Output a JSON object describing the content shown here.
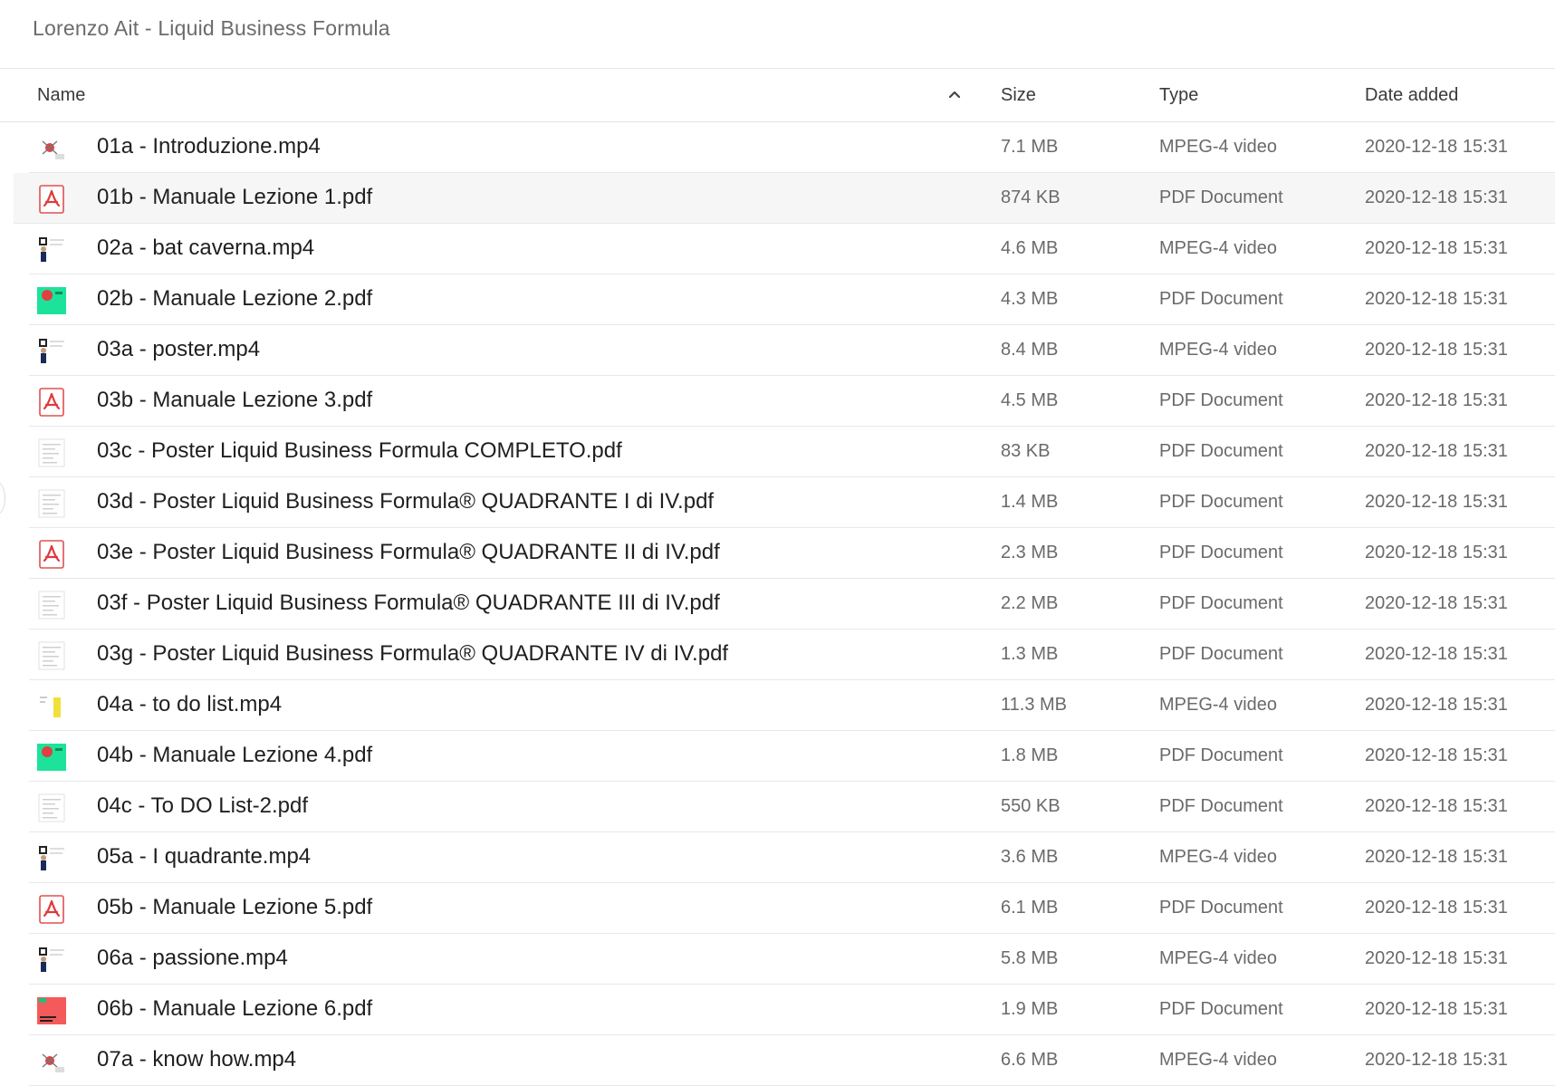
{
  "window": {
    "title": "Lorenzo Ait - Liquid Business Formula"
  },
  "columns": {
    "name": "Name",
    "size": "Size",
    "type": "Type",
    "date": "Date added"
  },
  "sort": {
    "column": "name",
    "direction": "ascending",
    "icon": "chevron-up-icon"
  },
  "files": [
    {
      "name": "01a - Introduzione.mp4",
      "size": "7.1 MB",
      "type": "MPEG-4 video",
      "date": "2020-12-18 15:31",
      "thumb": "video-thumb-red"
    },
    {
      "name": "01b - Manuale Lezione 1.pdf",
      "size": "874 KB",
      "type": "PDF Document",
      "date": "2020-12-18 15:31",
      "thumb": "pdf-icon",
      "selected": true
    },
    {
      "name": "02a - bat caverna.mp4",
      "size": "4.6 MB",
      "type": "MPEG-4 video",
      "date": "2020-12-18 15:31",
      "thumb": "video-thumb-person"
    },
    {
      "name": "02b - Manuale Lezione 2.pdf",
      "size": "4.3 MB",
      "type": "PDF Document",
      "date": "2020-12-18 15:31",
      "thumb": "doc-thumb-green"
    },
    {
      "name": "03a - poster.mp4",
      "size": "8.4 MB",
      "type": "MPEG-4 video",
      "date": "2020-12-18 15:31",
      "thumb": "video-thumb-person"
    },
    {
      "name": "03b - Manuale Lezione 3.pdf",
      "size": "4.5 MB",
      "type": "PDF Document",
      "date": "2020-12-18 15:31",
      "thumb": "pdf-icon"
    },
    {
      "name": "03c - Poster Liquid Business Formula COMPLETO.pdf",
      "size": "83 KB",
      "type": "PDF Document",
      "date": "2020-12-18 15:31",
      "thumb": "doc-thumb-sheet"
    },
    {
      "name": "03d - Poster Liquid Business Formula® QUADRANTE I di IV.pdf",
      "size": "1.4 MB",
      "type": "PDF Document",
      "date": "2020-12-18 15:31",
      "thumb": "doc-thumb-sheet"
    },
    {
      "name": "03e - Poster Liquid Business Formula® QUADRANTE II di IV.pdf",
      "size": "2.3 MB",
      "type": "PDF Document",
      "date": "2020-12-18 15:31",
      "thumb": "pdf-icon"
    },
    {
      "name": "03f - Poster Liquid Business Formula® QUADRANTE III di IV.pdf",
      "size": "2.2 MB",
      "type": "PDF Document",
      "date": "2020-12-18 15:31",
      "thumb": "doc-thumb-sheet"
    },
    {
      "name": "03g - Poster Liquid Business Formula® QUADRANTE IV di IV.pdf",
      "size": "1.3 MB",
      "type": "PDF Document",
      "date": "2020-12-18 15:31",
      "thumb": "doc-thumb-sheet"
    },
    {
      "name": "04a - to do list.mp4",
      "size": "11.3 MB",
      "type": "MPEG-4 video",
      "date": "2020-12-18 15:31",
      "thumb": "video-thumb-yellow"
    },
    {
      "name": "04b - Manuale Lezione 4.pdf",
      "size": "1.8 MB",
      "type": "PDF Document",
      "date": "2020-12-18 15:31",
      "thumb": "doc-thumb-green"
    },
    {
      "name": "04c - To DO List-2.pdf",
      "size": "550 KB",
      "type": "PDF Document",
      "date": "2020-12-18 15:31",
      "thumb": "doc-thumb-sheet"
    },
    {
      "name": "05a - I quadrante.mp4",
      "size": "3.6 MB",
      "type": "MPEG-4 video",
      "date": "2020-12-18 15:31",
      "thumb": "video-thumb-person"
    },
    {
      "name": "05b - Manuale Lezione 5.pdf",
      "size": "6.1 MB",
      "type": "PDF Document",
      "date": "2020-12-18 15:31",
      "thumb": "pdf-icon"
    },
    {
      "name": "06a - passione.mp4",
      "size": "5.8 MB",
      "type": "MPEG-4 video",
      "date": "2020-12-18 15:31",
      "thumb": "video-thumb-person"
    },
    {
      "name": "06b - Manuale Lezione 6.pdf",
      "size": "1.9 MB",
      "type": "PDF Document",
      "date": "2020-12-18 15:31",
      "thumb": "doc-thumb-red"
    },
    {
      "name": "07a - know how.mp4",
      "size": "6.6 MB",
      "type": "MPEG-4 video",
      "date": "2020-12-18 15:31",
      "thumb": "video-thumb-red"
    }
  ]
}
